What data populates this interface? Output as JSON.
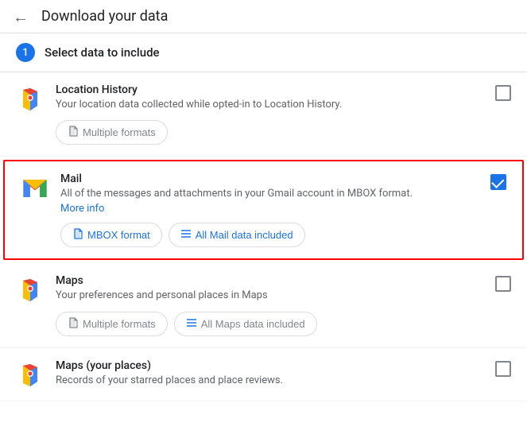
{
  "header": {
    "back_label": "←",
    "title": "Download your data"
  },
  "step": {
    "number": "1",
    "label": "Select data to include"
  },
  "items": [
    {
      "id": "location-history",
      "title": "Location History",
      "description": "Your location data collected while opted-in to Location History.",
      "icon_type": "maps",
      "checked": false,
      "format_buttons": [
        {
          "label": "Multiple formats",
          "icon": "📄",
          "disabled": true
        }
      ],
      "more_info": null,
      "highlighted": false
    },
    {
      "id": "mail",
      "title": "Mail",
      "description": "All of the messages and attachments in your Gmail account in MBOX format.",
      "icon_type": "gmail",
      "checked": true,
      "format_buttons": [
        {
          "label": "MBOX format",
          "icon": "📄",
          "disabled": false
        },
        {
          "label": "All Mail data included",
          "icon": "≡",
          "disabled": false
        }
      ],
      "more_info": "More info",
      "highlighted": true
    },
    {
      "id": "maps",
      "title": "Maps",
      "description": "Your preferences and personal places in Maps",
      "icon_type": "maps",
      "checked": false,
      "format_buttons": [
        {
          "label": "Multiple formats",
          "icon": "📄",
          "disabled": true
        },
        {
          "label": "All Maps data included",
          "icon": "≡",
          "disabled": true
        }
      ],
      "more_info": null,
      "highlighted": false
    },
    {
      "id": "maps-places",
      "title": "Maps (your places)",
      "description": "Records of your starred places and place reviews.",
      "icon_type": "maps",
      "checked": false,
      "format_buttons": [],
      "more_info": null,
      "highlighted": false
    }
  ]
}
